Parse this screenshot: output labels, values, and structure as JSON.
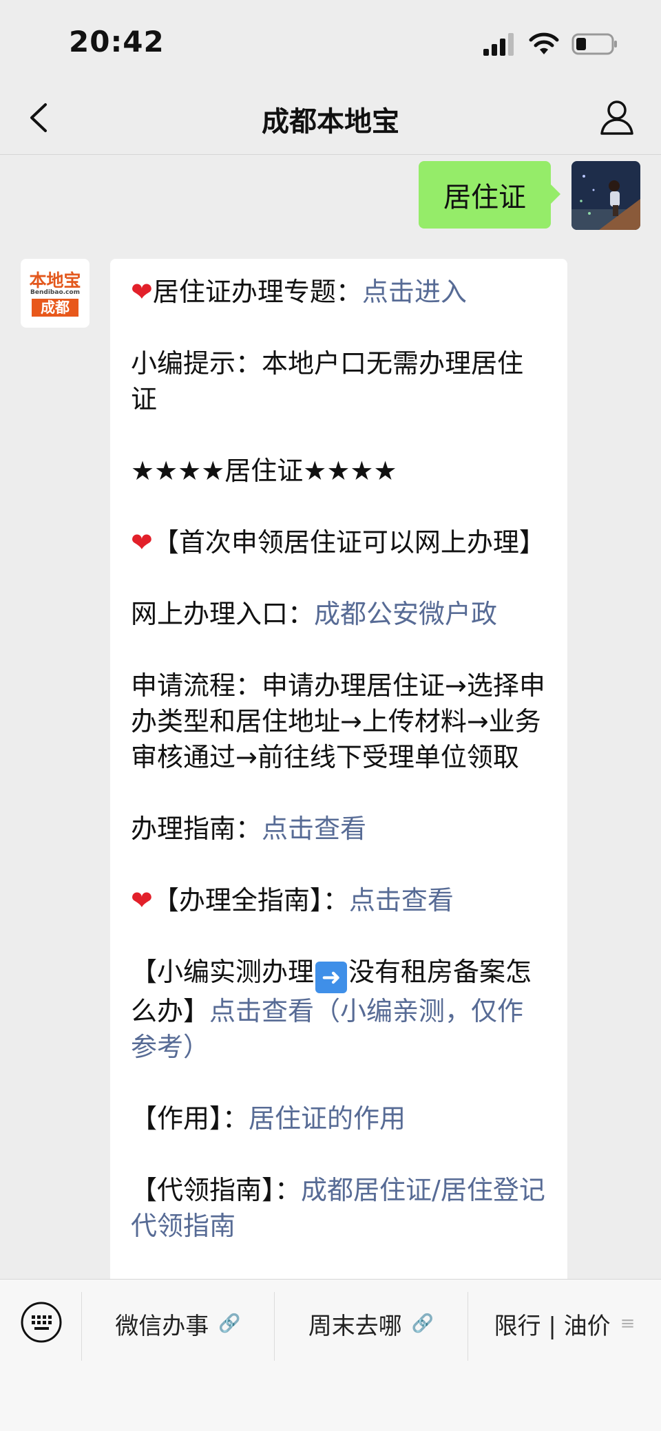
{
  "status": {
    "time": "20:42"
  },
  "nav": {
    "title": "成都本地宝"
  },
  "outgoing": {
    "text": "居住证"
  },
  "bot": {
    "logo_cn": "本地宝",
    "logo_en": "Bendibao.com",
    "logo_city": "成都"
  },
  "message": {
    "l1_text": "居住证办理专题：",
    "l1_link": "点击进入",
    "l2_text": "小编提示：本地户口无需办理居住证",
    "l3_text": "★★★★居住证★★★★",
    "l4_text": "【首次申领居住证可以网上办理】",
    "l5_text": "网上办理入口：",
    "l5_link": "成都公安微户政",
    "l6_text": "申请流程：申请办理居住证→选择申办类型和居住地址→上传材料→业务审核通过→前往线下受理单位领取",
    "l7_text": "办理指南：",
    "l7_link": "点击查看",
    "l8_text": "【办理全指南】：",
    "l8_link": "点击查看",
    "l9_text_a": "【小编实测办理",
    "l9_text_b": "没有租房备案怎么办】",
    "l9_link": "点击查看（小编亲测，仅作参考）",
    "l10_text": "【作用】：",
    "l10_link": "居住证的作用",
    "l11_text": "【代领指南】：",
    "l11_link": "成都居住证/居住登记代领指南"
  },
  "menu": {
    "item1": "微信办事",
    "item2": "周末去哪",
    "item3": "限行 | 油价"
  }
}
